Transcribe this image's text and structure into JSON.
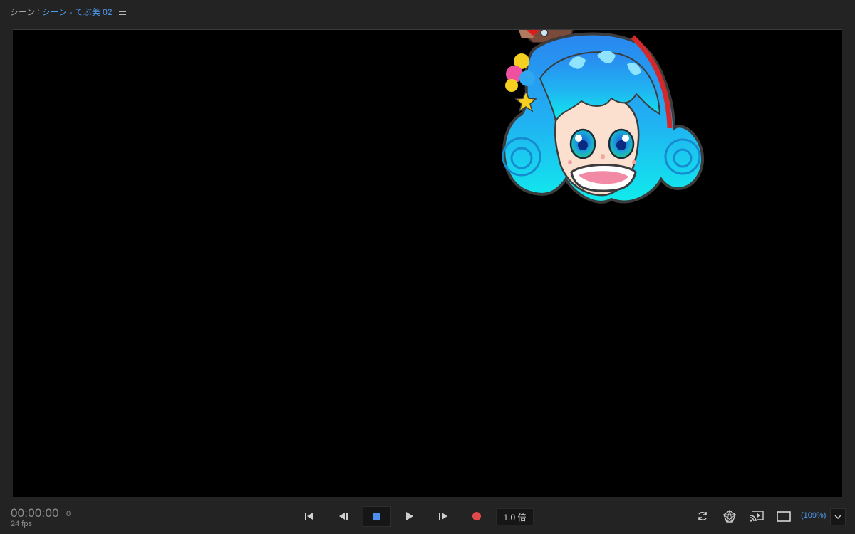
{
  "header": {
    "scene_prefix": "シーン",
    "separator": ":",
    "scene_name": "シーン - てぶ美 02",
    "menu_icon": "hamburger-menu-icon"
  },
  "viewer": {
    "background": "#000000",
    "content": "puppet-character"
  },
  "status": {
    "timecode": "00:00:00",
    "frame": "0",
    "fps": "24 fps"
  },
  "transport": {
    "go_to_start_icon": "skip-to-start-icon",
    "step_back_icon": "step-back-icon",
    "stop_icon": "stop-icon",
    "play_icon": "play-icon",
    "step_forward_icon": "step-forward-icon",
    "record_icon": "record-icon",
    "speed_label": "1.0 倍",
    "accent_color": "#4e8ef0",
    "record_color": "#e04a4a"
  },
  "view_controls": {
    "refresh_icon": "refresh-icon",
    "mesh_icon": "mesh-icon",
    "cast_icon": "cast-icon",
    "frame_icon": "frame-icon",
    "zoom_label": "(109%)",
    "zoom_dropdown_icon": "chevron-down-icon"
  }
}
